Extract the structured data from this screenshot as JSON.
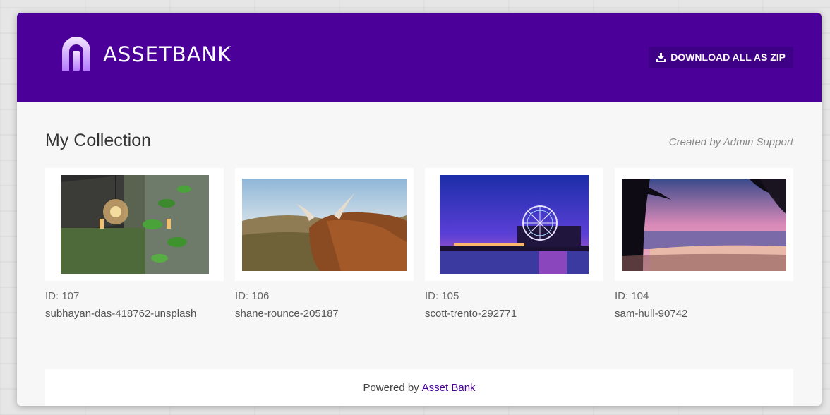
{
  "brand": {
    "name": "ASSETBANK",
    "color": "#4a0099"
  },
  "header": {
    "download_label": "DOWNLOAD ALL AS ZIP",
    "download_icon": "download-icon"
  },
  "collection": {
    "title": "My Collection",
    "created_by": "Created by Admin Support"
  },
  "assets": [
    {
      "id": "ID: 107",
      "name": "subhayan-das-418762-unsplash",
      "image": "hanging light bulb with green leaves"
    },
    {
      "id": "ID: 106",
      "name": "shane-rounce-205187",
      "image": "highland cow on hillside"
    },
    {
      "id": "ID: 105",
      "name": "scott-trento-292771",
      "image": "pier with ferris wheel at dusk"
    },
    {
      "id": "ID: 104",
      "name": "sam-hull-90742",
      "image": "beach at sunset with palm tree"
    }
  ],
  "footer": {
    "prefix": "Powered by",
    "link": "Asset Bank"
  }
}
